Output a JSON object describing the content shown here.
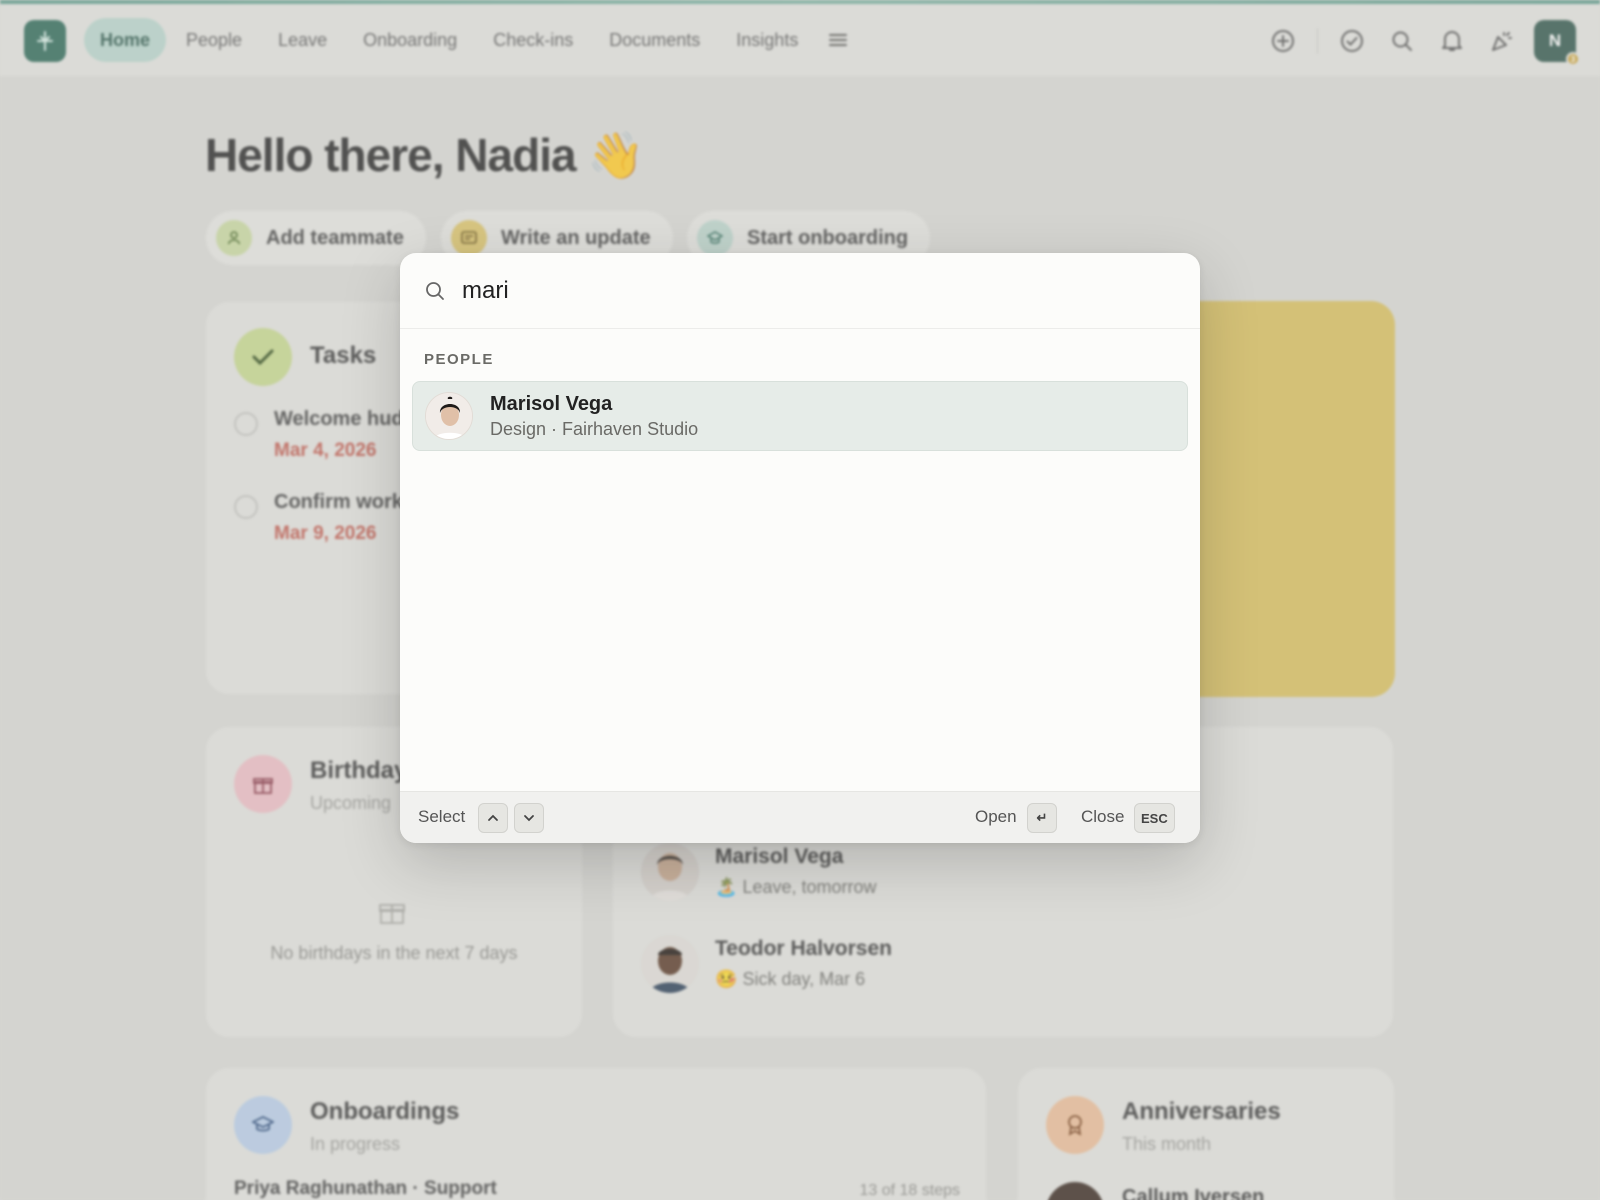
{
  "nav": {
    "tabs": [
      "Home",
      "People",
      "Leave",
      "Onboarding",
      "Check-ins",
      "Documents",
      "Insights"
    ],
    "active": "Home",
    "avatar_initial": "N",
    "avatar_badge": "3"
  },
  "greeting": "Hello there, Nadia 👋",
  "quick_actions": {
    "add_teammate": "Add teammate",
    "write_update": "Write an update",
    "start_onboarding": "Start onboarding"
  },
  "tasks": {
    "title": "Tasks",
    "items": [
      {
        "title": "Welcome hud",
        "date": "Mar 4, 2026"
      },
      {
        "title": "Confirm work",
        "date": "Mar 9, 2026"
      }
    ]
  },
  "birthdays": {
    "title": "Birthday",
    "subtitle": "Upcoming",
    "empty": "No birthdays in the next 7 days"
  },
  "away": {
    "people": [
      {
        "name": "Marisol Vega",
        "status": "Leave, tomorrow",
        "emoji": "🏝️"
      },
      {
        "name": "Teodor Halvorsen",
        "status": "Sick day, Mar 6",
        "emoji": "🤒"
      }
    ]
  },
  "onboardings": {
    "title": "Onboardings",
    "subtitle": "In progress",
    "row_name": "Priya Raghunathan · Support",
    "row_progress": "13 of 18 steps"
  },
  "anniversaries": {
    "title": "Anniversaries",
    "subtitle": "This month",
    "row_name": "Callum Iversen"
  },
  "palette": {
    "query": "mari",
    "section": "PEOPLE",
    "result": {
      "name": "Marisol Vega",
      "detail": "Design · Fairhaven Studio"
    },
    "footer": {
      "select": "Select",
      "open": "Open",
      "open_key": "↵",
      "close": "Close",
      "close_key": "ESC"
    }
  },
  "colors": {
    "brand": "#2f6a59",
    "nav_active_bg": "#b8d5cc",
    "date_red": "#c05a4e",
    "highlight_yellow": "#d9bf5e"
  }
}
